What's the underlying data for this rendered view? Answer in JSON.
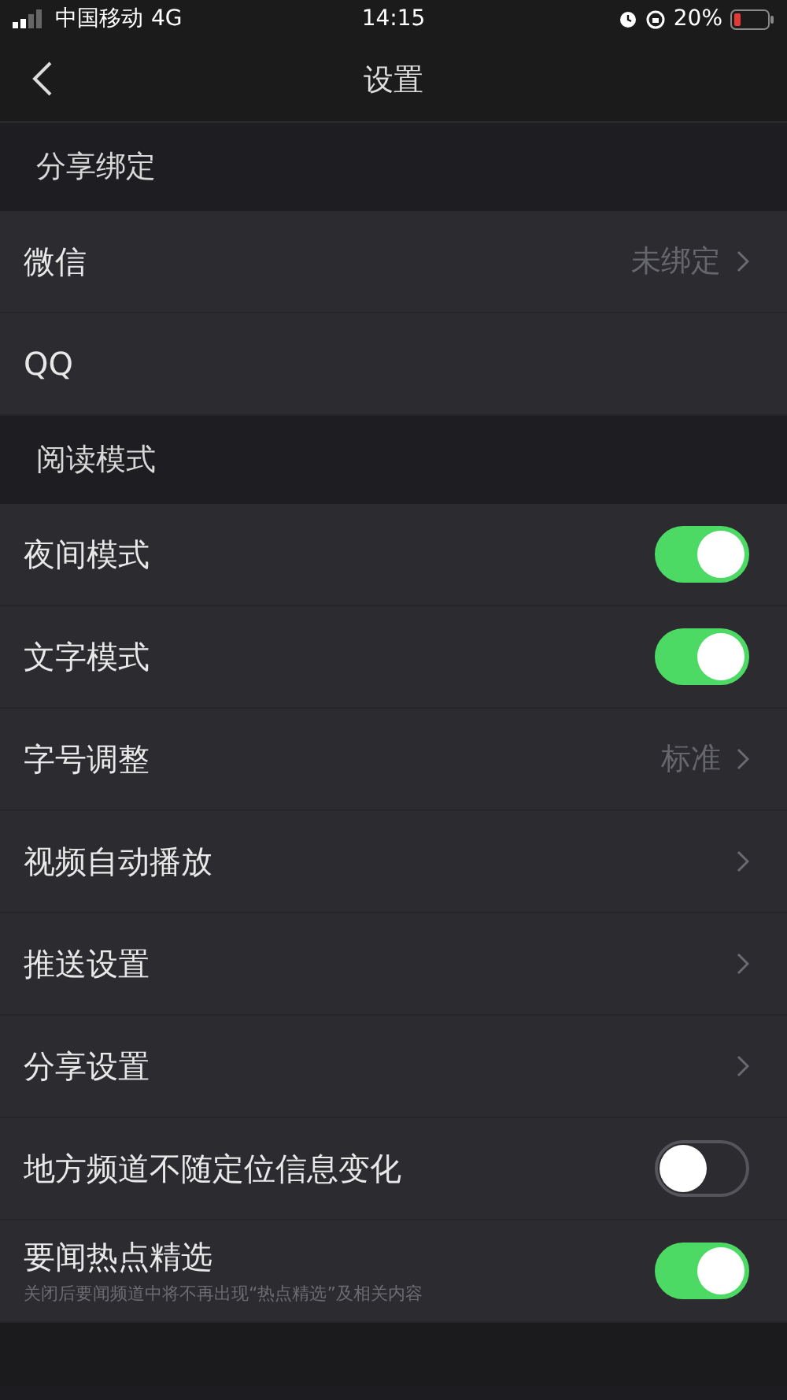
{
  "status_bar": {
    "carrier": "中国移动",
    "network": "4G",
    "time": "14:15",
    "battery": "20%"
  },
  "nav": {
    "title": "设置"
  },
  "sections": [
    {
      "title": "分享绑定",
      "rows": [
        {
          "kind": "value",
          "label": "微信",
          "value": "未绑定"
        },
        {
          "kind": "plain",
          "label": "QQ"
        }
      ]
    },
    {
      "title": "阅读模式",
      "rows": [
        {
          "kind": "toggle",
          "label": "夜间模式",
          "on": true
        },
        {
          "kind": "toggle",
          "label": "文字模式",
          "on": true
        },
        {
          "kind": "value",
          "label": "字号调整",
          "value": "标准"
        },
        {
          "kind": "link",
          "label": "视频自动播放"
        },
        {
          "kind": "link",
          "label": "推送设置"
        },
        {
          "kind": "link",
          "label": "分享设置"
        },
        {
          "kind": "toggle",
          "label": "地方频道不随定位信息变化",
          "on": false
        },
        {
          "kind": "toggle",
          "label": "要闻热点精选",
          "on": true,
          "note": "关闭后要闻频道中将不再出现“热点精选”及相关内容"
        }
      ]
    }
  ]
}
